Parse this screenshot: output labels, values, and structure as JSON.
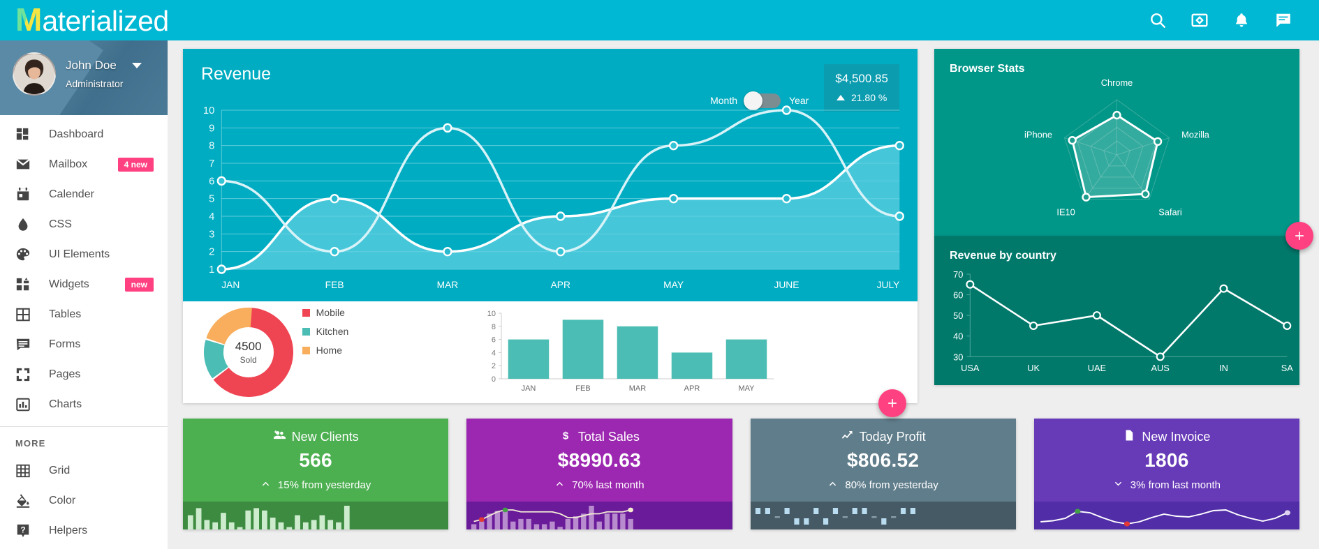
{
  "brand": {
    "logo_first": "M",
    "logo_rest": "aterialized"
  },
  "topbar": {
    "icons": [
      {
        "name": "search-icon",
        "label": "Search"
      },
      {
        "name": "fullscreen-icon",
        "label": "Fullscreen"
      },
      {
        "name": "bell-icon",
        "label": "Notifications"
      },
      {
        "name": "chat-icon",
        "label": "Messages"
      }
    ]
  },
  "profile": {
    "name": "John Doe",
    "role": "Administrator"
  },
  "sidebar": {
    "items": [
      {
        "label": "Dashboard",
        "icon": "dashboard-icon",
        "badge": ""
      },
      {
        "label": "Mailbox",
        "icon": "mail-icon",
        "badge": "4 new"
      },
      {
        "label": "Calender",
        "icon": "calendar-icon",
        "badge": ""
      },
      {
        "label": "CSS",
        "icon": "droplet-icon",
        "badge": ""
      },
      {
        "label": "UI Elements",
        "icon": "palette-icon",
        "badge": ""
      },
      {
        "label": "Widgets",
        "icon": "widgets-icon",
        "badge": "new"
      },
      {
        "label": "Tables",
        "icon": "table-icon",
        "badge": ""
      },
      {
        "label": "Forms",
        "icon": "forms-icon",
        "badge": ""
      },
      {
        "label": "Pages",
        "icon": "pages-icon",
        "badge": ""
      },
      {
        "label": "Charts",
        "icon": "chart-icon",
        "badge": ""
      }
    ],
    "more_label": "MORE",
    "more_items": [
      {
        "label": "Grid",
        "icon": "grid-icon"
      },
      {
        "label": "Color",
        "icon": "color-fill-icon"
      },
      {
        "label": "Helpers",
        "icon": "help-icon"
      }
    ]
  },
  "revenue": {
    "title": "Revenue",
    "toggle_left": "Month",
    "toggle_right": "Year",
    "amount": "$4,500.85",
    "delta": "21.80 %",
    "fab_label": "+"
  },
  "donut": {
    "center_value": "4500",
    "center_label": "Sold",
    "legend": [
      {
        "label": "Mobile",
        "color": "#ef4452"
      },
      {
        "label": "Kitchen",
        "color": "#4cbdb4"
      },
      {
        "label": "Home",
        "color": "#f9ae5d"
      }
    ]
  },
  "browser_stats": {
    "title": "Browser Stats"
  },
  "country": {
    "title": "Revenue by country",
    "fab_label": "+"
  },
  "stat_cards": [
    {
      "title": "New Clients",
      "icon": "add-people-icon",
      "value": "566",
      "sub": "15% from yesterday",
      "trend": "up",
      "color": "#4caf50",
      "spark_color": "#3d8b40",
      "bar_color": "#cdeccd",
      "spark_type": "bars",
      "spark_values": [
        6,
        9,
        4,
        3,
        7,
        3,
        1,
        8,
        9,
        8,
        5,
        3,
        1,
        6,
        3,
        4,
        6,
        4,
        3,
        10
      ]
    },
    {
      "title": "Total Sales",
      "icon": "dollar-icon",
      "value": "$8990.63",
      "sub": "70% last month",
      "trend": "up",
      "color": "#9c27b0",
      "spark_color": "#6a1b9a",
      "bar_color": "#e2c6ea",
      "spark_type": "bars-line",
      "spark_values": [
        2,
        3,
        6,
        7,
        7,
        3,
        4,
        4,
        2,
        2,
        3,
        1,
        4,
        5,
        6,
        9,
        3,
        6,
        6,
        6,
        4
      ],
      "spark_line": [
        2,
        3,
        5,
        7,
        8,
        8,
        7,
        7,
        7,
        7,
        7,
        6,
        4,
        4,
        5,
        6,
        6,
        7,
        7,
        7,
        8
      ],
      "dot_low_index": 1,
      "dot_high_index": 4
    },
    {
      "title": "Today Profit",
      "icon": "trend-icon",
      "value": "$806.52",
      "sub": "80% from yesterday",
      "trend": "up",
      "color": "#607d8b",
      "spark_color": "#455a64",
      "bar_color": "#b9dcf0",
      "spark_type": "blocks",
      "spark_values": [
        7,
        7,
        2,
        7,
        3,
        3,
        7,
        3,
        7,
        2,
        7,
        7,
        1,
        3,
        2,
        7,
        7
      ]
    },
    {
      "title": "New Invoice",
      "icon": "file-icon",
      "value": "1806",
      "sub": "3% from last month",
      "trend": "down",
      "color": "#673ab7",
      "spark_color": "#512da8",
      "bar_color": "#ffffff",
      "spark_type": "line",
      "spark_line": [
        3,
        3.3,
        4,
        6,
        5.6,
        4.2,
        3,
        2.4,
        3,
        4.2,
        5.2,
        4.6,
        4.4,
        5.2,
        6.2,
        6.4,
        5,
        4,
        3.2,
        4,
        5.6
      ],
      "dot_low_index": 7,
      "dot_high_index": 3
    }
  ],
  "chart_data": [
    {
      "type": "line",
      "title": "Revenue",
      "categories": [
        "JAN",
        "FEB",
        "MAR",
        "APR",
        "MAY",
        "JUNE",
        "JULY"
      ],
      "series": [
        {
          "name": "Series A",
          "values": [
            6,
            2,
            9,
            2,
            8,
            10,
            4
          ],
          "color": "#e7f7fa"
        },
        {
          "name": "Series B",
          "values": [
            1,
            5,
            2,
            4,
            5,
            5,
            8
          ],
          "color": "#ffffff"
        }
      ],
      "ylim": [
        1,
        10
      ],
      "yticks": [
        1,
        2,
        3,
        4,
        5,
        6,
        7,
        8,
        9,
        10
      ],
      "xlabel": "",
      "ylabel": "",
      "grid": true,
      "legend": "none"
    },
    {
      "type": "pie",
      "title": "",
      "labels": [
        "Mobile",
        "Kitchen",
        "Home"
      ],
      "values": [
        58,
        13,
        19
      ],
      "colors": [
        "#ef4452",
        "#4cbdb4",
        "#f9ae5d"
      ],
      "center_text": "4500",
      "center_sub": "Sold",
      "legend": "right"
    },
    {
      "type": "bar",
      "title": "",
      "categories": [
        "JAN",
        "FEB",
        "MAR",
        "APR",
        "MAY"
      ],
      "values": [
        6,
        9,
        8,
        4,
        6
      ],
      "ylim": [
        0,
        10
      ],
      "yticks": [
        0,
        2,
        4,
        6,
        8,
        10
      ],
      "color": "#4cbdb4",
      "xlabel": "",
      "ylabel": "",
      "grid": false
    },
    {
      "type": "radar",
      "title": "Browser Stats",
      "categories": [
        "Chrome",
        "Mozilla",
        "Safari",
        "IE10",
        "iPhone"
      ],
      "values": [
        72,
        78,
        88,
        95,
        85
      ],
      "max": 100,
      "color": "#ffffff",
      "grid": true
    },
    {
      "type": "line",
      "title": "Revenue by country",
      "categories": [
        "USA",
        "UK",
        "UAE",
        "AUS",
        "IN",
        "SA"
      ],
      "values": [
        65,
        45,
        50,
        30,
        63,
        45
      ],
      "ylim": [
        30,
        70
      ],
      "yticks": [
        30,
        40,
        50,
        60,
        70
      ],
      "color": "#ffffff",
      "xlabel": "",
      "ylabel": "",
      "grid": false
    }
  ]
}
